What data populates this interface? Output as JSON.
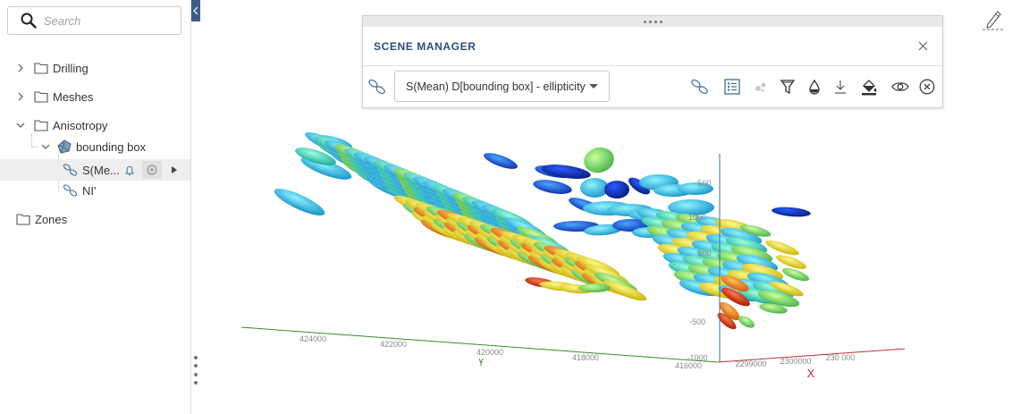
{
  "search": {
    "placeholder": "Search"
  },
  "tree": {
    "drilling": "Drilling",
    "meshes": "Meshes",
    "anisotropy": "Anisotropy",
    "bounding_box": "bounding box",
    "smean": "S(Me...",
    "ni": "NI'",
    "zones": "Zones"
  },
  "scene_manager": {
    "title": "SCENE MANAGER",
    "selected_layer": "S(Mean) D[bounding box] - ellipticity"
  },
  "axes": {
    "x_ticks": [
      "424000",
      "422000",
      "420000",
      "418000",
      "416000"
    ],
    "y_ticks": [
      "2299000",
      "2300000",
      "230 000"
    ],
    "z_ticks": [
      "500",
      "1000",
      "500",
      "-500",
      "-1000"
    ],
    "x_axis_label": "X"
  },
  "colors": {
    "accent": "#2a4f78",
    "collapse_handle": "#3a5f85",
    "icon_teal": "#3a6f9a",
    "axis_x": "#c03030",
    "axis_y": "#3b8a2a",
    "axis_z": "#3a6f9a"
  }
}
